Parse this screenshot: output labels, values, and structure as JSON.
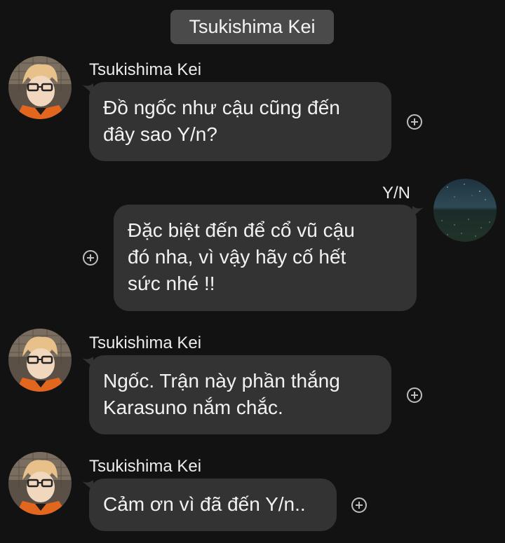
{
  "chat": {
    "title": "Tsukishima Kei"
  },
  "messages": [
    {
      "sender": "Tsukishima Kei",
      "lines": [
        "Đồ ngốc như cậu cũng đến",
        "đây sao Y/n?"
      ]
    },
    {
      "sender": "Y/N",
      "lines": [
        "Đặc biệt đến để cổ vũ cậu",
        "đó nha, vì vậy hãy cố hết",
        "sức nhé !!"
      ]
    },
    {
      "sender": "Tsukishima Kei",
      "lines": [
        "Ngốc. Trận này phần thắng",
        "Karasuno nắm chắc."
      ]
    },
    {
      "sender": "Tsukishima Kei",
      "lines": [
        "Cảm ơn vì đã đến Y/n.."
      ]
    }
  ],
  "icons": {
    "react": "add-reaction-icon",
    "avatar_left": "tsukishima-avatar",
    "avatar_right": "night-sky-avatar"
  },
  "colors": {
    "background": "#121212",
    "bubble": "#333333",
    "header_chip": "#4a4a4a",
    "text": "#f2f2f2"
  }
}
